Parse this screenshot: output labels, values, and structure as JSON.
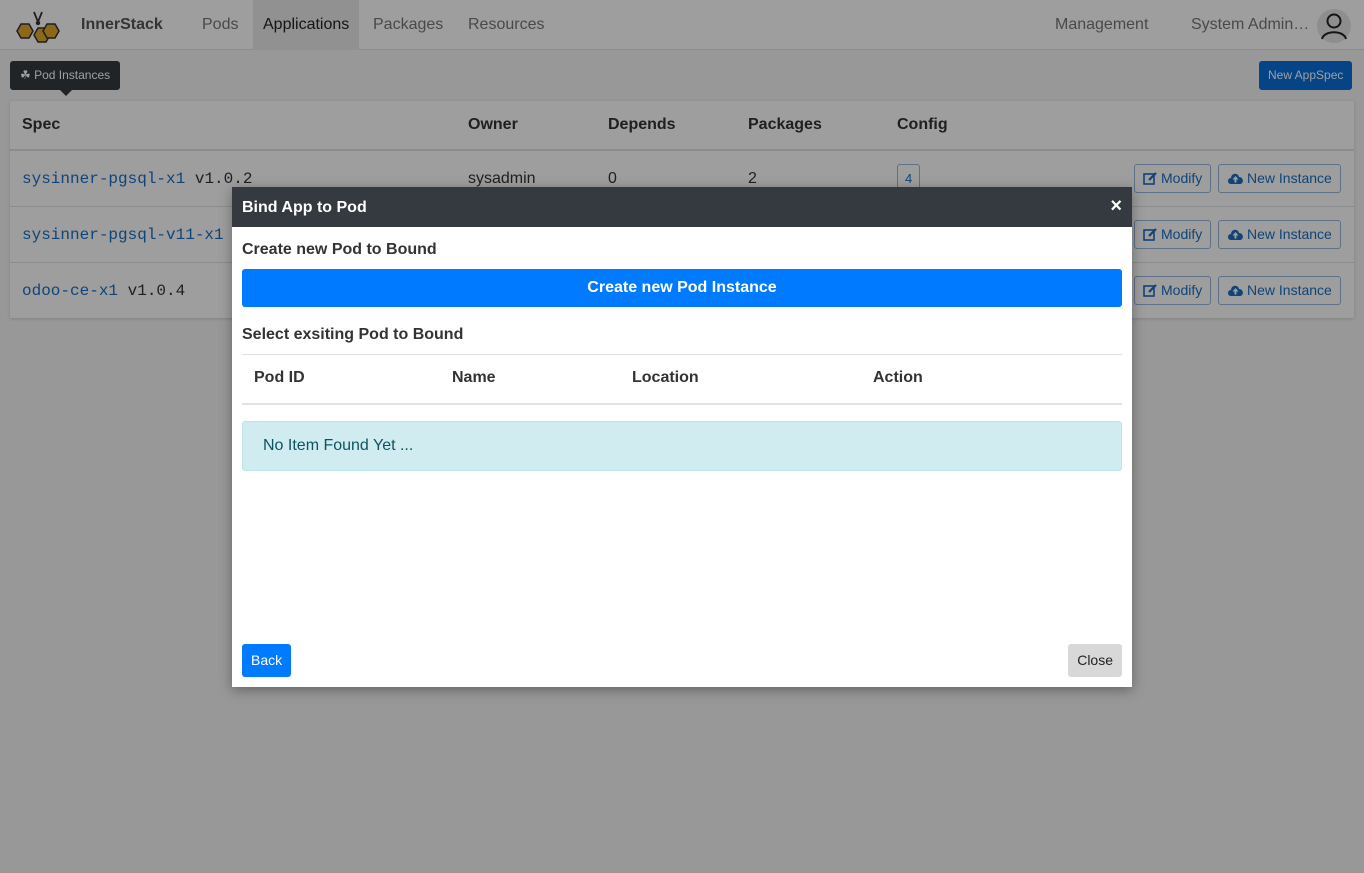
{
  "nav": {
    "brand": "InnerStack",
    "items": [
      "Pods",
      "Applications",
      "Packages",
      "Resources"
    ],
    "active": "Applications",
    "management": "Management",
    "user": "System Admin…"
  },
  "toolbar": {
    "pod_instances_label": "Pod Instances",
    "new_appspec_label": "New AppSpec"
  },
  "table": {
    "headers": [
      "Spec",
      "Owner",
      "Depends",
      "Packages",
      "Config"
    ],
    "rows": [
      {
        "spec": "sysinner-pgsql-x1",
        "version": "v1.0.2",
        "owner": "sysadmin",
        "depends": "0",
        "packages": "2",
        "config": "4"
      },
      {
        "spec": "sysinner-pgsql-v11-x1",
        "version": "",
        "owner": "",
        "depends": "",
        "packages": "",
        "config": ""
      },
      {
        "spec": "odoo-ce-x1",
        "version": "v1.0.4",
        "owner": "",
        "depends": "",
        "packages": "",
        "config": ""
      }
    ],
    "modify_label": "Modify",
    "new_instance_label": "New Instance"
  },
  "modal": {
    "title": "Bind App to Pod",
    "close_x": "×",
    "create_section_title": "Create new Pod to Bound",
    "create_button": "Create new Pod Instance",
    "select_section_title": "Select exsiting Pod to Bound",
    "headers": [
      "Pod ID",
      "Name",
      "Location",
      "Action"
    ],
    "empty_message": "No Item Found Yet ...",
    "back_label": "Back",
    "close_label": "Close"
  },
  "colors": {
    "primary": "#007bff",
    "dark": "#343a40",
    "link": "#1a6fc4",
    "alert_bg": "#d1ecf1",
    "logo_gold": "#e0a92a"
  }
}
